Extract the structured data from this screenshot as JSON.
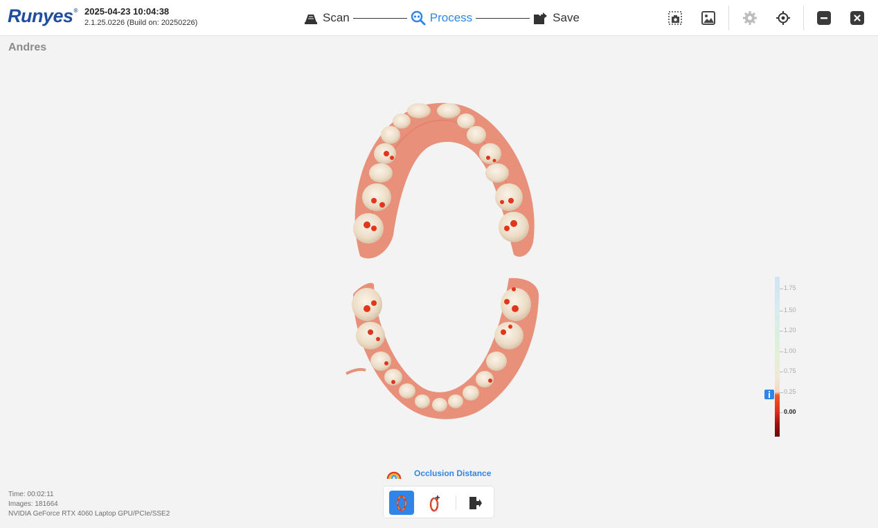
{
  "header": {
    "brand": "Runyes",
    "brand_mark": "®",
    "datetime": "2025-04-23 10:04:38",
    "version": "2.1.25.0226 (Build on: 20250226)",
    "steps": [
      {
        "label": "Scan",
        "icon": "scanner-icon",
        "active": false
      },
      {
        "label": "Process",
        "icon": "process-magnifier-icon",
        "active": true
      },
      {
        "label": "Save",
        "icon": "save-folder-icon",
        "active": false
      }
    ],
    "tools": [
      "screenshot-icon",
      "gallery-icon",
      "settings-gear-icon",
      "target-icon",
      "minimize-icon",
      "close-icon"
    ]
  },
  "patient_name": "Andres",
  "legend": {
    "labels": [
      "1.75",
      "1.50",
      "1.20",
      "1.00",
      "0.75",
      "0.25",
      "0.00"
    ],
    "current": "0.00"
  },
  "occlusion": {
    "title": "Occlusion Distance",
    "tools": [
      "occlusion-upper-icon",
      "occlusion-lower-icon",
      "exit-icon"
    ],
    "active_tool": "occlusion-upper-icon"
  },
  "status": {
    "time": "Time: 00:02:11",
    "images": "Images: 181664",
    "gpu": "NVIDIA GeForce RTX 4060 Laptop GPU/PCIe/SSE2"
  },
  "colors": {
    "accent": "#2f86e8",
    "brand": "#1f4e9e",
    "gum": "#e8907a",
    "tooth": "#efe0cc",
    "contact": "#e2361c"
  }
}
